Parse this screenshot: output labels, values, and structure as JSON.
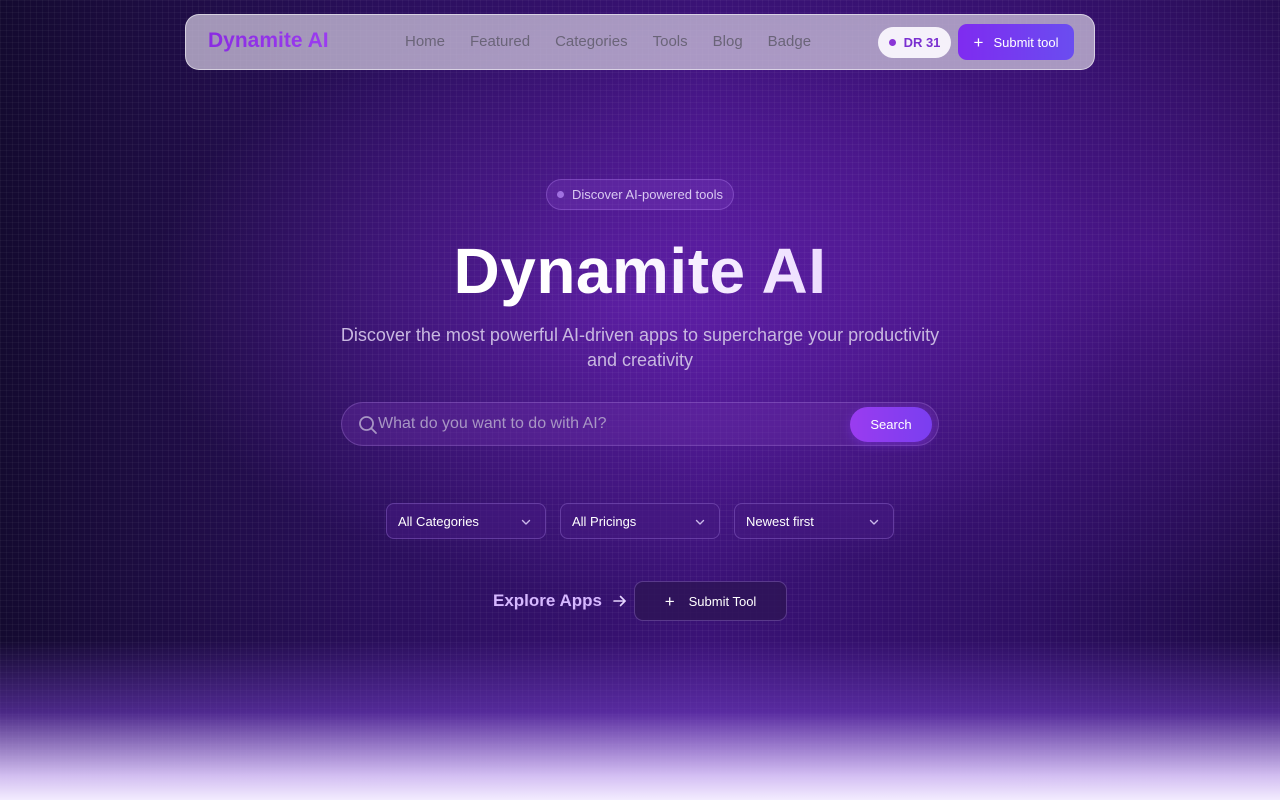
{
  "nav": {
    "logo": "Dynamite AI",
    "links": [
      "Home",
      "Featured",
      "Categories",
      "Tools",
      "Blog",
      "Badge"
    ],
    "dr_badge": "DR 31",
    "submit_label": "Submit tool"
  },
  "hero": {
    "pill": "Discover AI-powered tools",
    "title": "Dynamite AI",
    "subtitle": "Discover the most powerful AI-driven apps to supercharge your productivity and creativity"
  },
  "search": {
    "placeholder": "What do you want to do with AI?",
    "button": "Search"
  },
  "filters": {
    "category": "All Categories",
    "pricing": "All Pricings",
    "sort": "Newest first"
  },
  "cta": {
    "explore": "Explore Apps",
    "submit": "Submit Tool"
  },
  "colors": {
    "accent": "#8a2be2",
    "button_gradient_start": "#7f2bf0",
    "button_gradient_end": "#6a4df0"
  },
  "icons": {
    "search": "search-icon",
    "chevron": "chevron-down-icon",
    "arrow": "arrow-right-icon",
    "plus": "plus-icon"
  }
}
